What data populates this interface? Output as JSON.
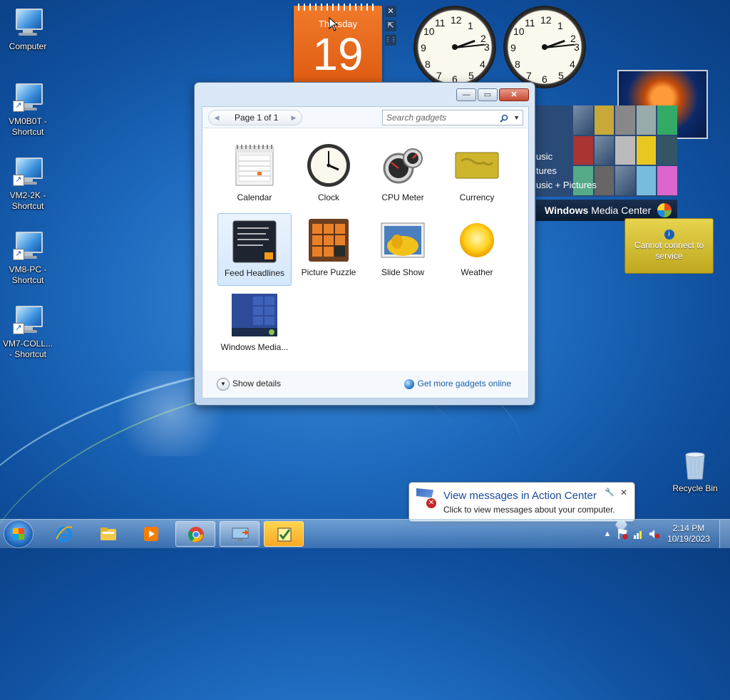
{
  "desktop": {
    "icons": [
      {
        "label": "Computer"
      },
      {
        "label": "VM0B0T -\nShortcut"
      },
      {
        "label": "VM2-2K -\nShortcut"
      },
      {
        "label": "VM8-PC -\nShortcut"
      },
      {
        "label": "VM7-COLL...\n- Shortcut"
      },
      {
        "label": "Recycle Bin"
      }
    ]
  },
  "calendar_gadget": {
    "day_name": "Thursday",
    "day_number": "19"
  },
  "gadget_controls": {
    "close": "✕",
    "resize": "⇱",
    "drag": "⋮⋮"
  },
  "media_center_gadget": {
    "menu": [
      "usic",
      "tures",
      "usic + Pictures"
    ],
    "brand_bold": "Windows",
    "brand_rest": " Media Center"
  },
  "currency_gadget": {
    "message": "Cannot connect to service"
  },
  "gadgets_window": {
    "pager": {
      "label": "Page 1 of 1"
    },
    "search": {
      "placeholder": "Search gadgets"
    },
    "gadgets": [
      {
        "label": "Calendar"
      },
      {
        "label": "Clock"
      },
      {
        "label": "CPU Meter"
      },
      {
        "label": "Currency"
      },
      {
        "label": "Feed Headlines",
        "selected": true
      },
      {
        "label": "Picture Puzzle"
      },
      {
        "label": "Slide Show"
      },
      {
        "label": "Weather"
      },
      {
        "label": "Windows Media..."
      }
    ],
    "show_details": "Show details",
    "get_more": "Get more gadgets online"
  },
  "notification": {
    "title": "View messages in Action Center",
    "text": "Click to view messages about your computer."
  },
  "taskbar": {
    "time": "2:14 PM",
    "date": "10/19/2023",
    "pinned": [
      "Internet Explorer",
      "Windows Explorer",
      "Windows Media Player",
      "Google Chrome",
      "Remote Desktop",
      "Checklist"
    ]
  },
  "colors": {
    "accent": "#1b4a9c",
    "desktop": "#1f6cc0",
    "calendar": "#e2641a"
  }
}
